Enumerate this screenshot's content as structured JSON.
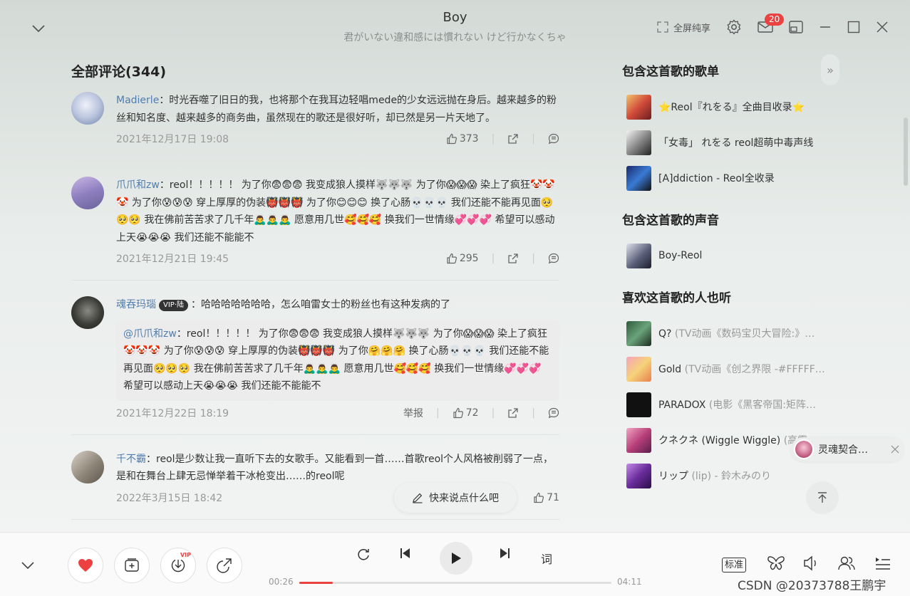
{
  "header": {
    "title": "Boy",
    "subtitle": "君がいない違和感には慣れない けど行かなくちゃ",
    "fullscreen_label": "全屏纯享",
    "mail_badge": "20"
  },
  "comments": {
    "heading": "全部评论(344)",
    "items": [
      {
        "user": "Madierle",
        "text": "：时光吞噬了旧日的我，也将那个在我耳边轻唱mede的少女远远抛在身后。越来越多的粉丝和知名度、越来越多的商务曲，虽然现在的歌还是很好听，却已然是另一片天地了。",
        "date": "2021年12月17日 19:08",
        "likes": "373"
      },
      {
        "user": "爪爪和zw",
        "text": "：reol！！！！！ 为了你😨😨😨 我变成狼人摸样🐺🐺🐺 为了你😱😱😱 染上了疯狂🤡🤡🤡 为了你😰😰😰 穿上厚厚的伪装👹👹👹 为了你😊😊😊 换了心肠💀💀💀 我们还能不能再见面🥺🥺🥺 我在佛前苦苦求了几千年🙇‍♂️🙇‍♂️🙇‍♂️ 愿意用几世🥰🥰🥰 换我们一世情缘💞💞💞 希望可以感动上天😭😭😭 我们还能不能能不",
        "date": "2021年12月21日 19:45",
        "likes": "295"
      },
      {
        "user": "魂吞玛瑙",
        "vip": "VIP·陆",
        "text": "：哈哈哈哈哈哈哈，怎么咱雷女士的粉丝也有这种发病的了",
        "quote_user": "@爪爪和zw",
        "quote_text": "：reol！！！！！ 为了你😨😨😨 我变成狼人摸样🐺🐺🐺 为了你😱😱😱 染上了疯狂🤡🤡🤡 为了你😰😰😰 穿上厚厚的伪装👹👹👹 为了你🤗🤗🤗 换了心肠💀💀💀 我们还能不能再见面🥺🥺🥺 我在佛前苦苦求了几千年🙇‍♂️🙇‍♂️🙇‍♂️ 愿意用几世🥰🥰🥰 换我们一世情缘💞💞💞 希望可以感动上天😭😭😭 我们还能不能能不",
        "report": "举报",
        "date": "2021年12月22日 18:19",
        "likes": "72"
      },
      {
        "user": "千不霸",
        "text": "：reol是少数让我一直听下去的女歌手。又能看到一首……首歌reol个人风格被削弱了一点，是和在舞台上肆无忌惮举着干冰枪变出……的reol呢",
        "date": "2022年3月15日 18:42",
        "likes": "71"
      }
    ],
    "quick_comment": "快来说点什么吧"
  },
  "right": {
    "playlists_heading": "包含这首歌的歌单",
    "playlists": [
      "⭐Reol『れをる』全曲目收录⭐",
      "「女毒」 れをる reol超萌中毒声线",
      "[A]ddiction - Reol全收录"
    ],
    "voices_heading": "包含这首歌的声音",
    "voices": [
      "Boy-Reol"
    ],
    "similar_heading": "喜欢这首歌的人也听",
    "similar": [
      {
        "name": "Q?",
        "extra": "(TV动画《数码宝贝大冒险:》…"
      },
      {
        "name": "Gold",
        "extra": "(TV动画《创之界限 -#FFFFF…"
      },
      {
        "name": "PARADOX",
        "extra": "(电影《黑客帝国:矩阵…"
      },
      {
        "name": "クネクネ (Wiggle Wiggle)",
        "extra": "(高露…"
      },
      {
        "name": "リップ",
        "extra": "(lip) - 鈴木みのり"
      }
    ],
    "popup_label": "灵魂契合…"
  },
  "player": {
    "current_time": "00:26",
    "total_time": "04:11",
    "progress": 0.107,
    "lyrics_label": "词",
    "quality_label": "标准",
    "vip_tag": "VIP",
    "accent": "#ec4141"
  },
  "watermark": "CSDN @20373788王鹏宇"
}
